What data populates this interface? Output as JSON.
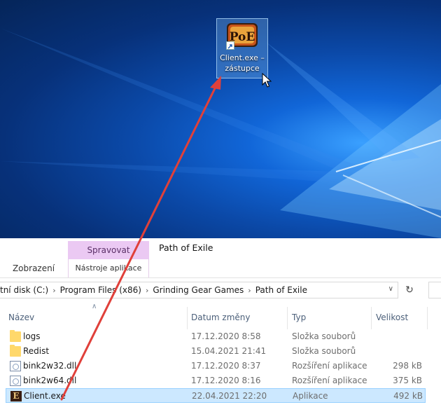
{
  "desktop": {
    "shortcut": {
      "label_line1": "Client.exe –",
      "label_line2": "zástupce",
      "icon": "poe-icon",
      "icon_text": "PoE"
    }
  },
  "ribbon": {
    "tab_view": "Zobrazení",
    "context_group_title": "Spravovat",
    "context_tab": "Nástroje aplikace",
    "window_title": "Path of Exile",
    "context_color": "#ebc9f3"
  },
  "address": {
    "crumbs": [
      "tní disk (C:)",
      "Program Files (x86)",
      "Grinding Gear Games",
      "Path of Exile"
    ]
  },
  "columns": {
    "name": "Název",
    "date": "Datum změny",
    "type": "Typ",
    "size": "Velikost"
  },
  "files": [
    {
      "name": "logs",
      "date": "17.12.2020 8:58",
      "type": "Složka souborů",
      "size": "",
      "icon": "folder-icon"
    },
    {
      "name": "Redist",
      "date": "15.04.2021 21:41",
      "type": "Složka souborů",
      "size": "",
      "icon": "folder-icon"
    },
    {
      "name": "bink2w32.dll",
      "date": "17.12.2020 8:37",
      "type": "Rozšíření aplikace",
      "size": "298 kB",
      "icon": "dll-icon"
    },
    {
      "name": "bink2w64.dll",
      "date": "17.12.2020 8:16",
      "type": "Rozšíření aplikace",
      "size": "375 kB",
      "icon": "dll-icon"
    },
    {
      "name": "Client.exe",
      "date": "22.04.2021 22:20",
      "type": "Aplikace",
      "size": "492 kB",
      "icon": "exe-icon",
      "exe_glyph": "E",
      "selected": true
    }
  ],
  "colors": {
    "selection": "#cce8ff",
    "arrow": "#e0403a",
    "desktop_blue": "#0b49a8"
  }
}
